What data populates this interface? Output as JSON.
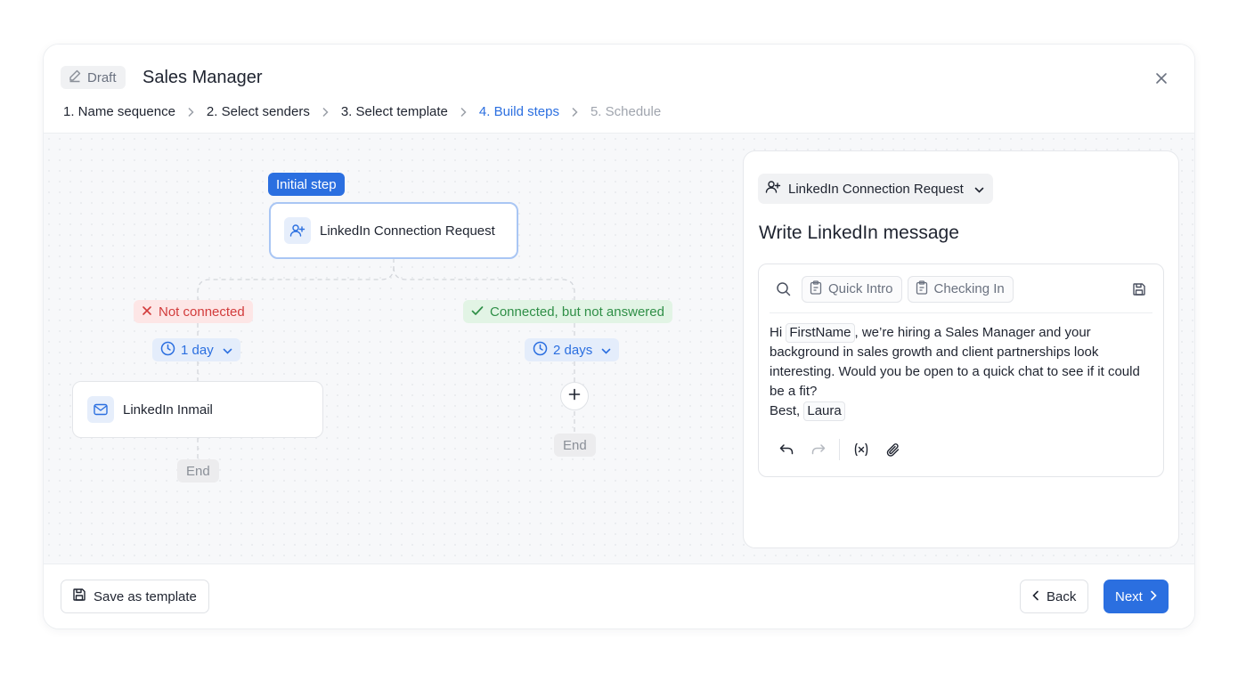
{
  "header": {
    "status_badge": "Draft",
    "title": "Sales Manager",
    "steps": [
      {
        "label": "1. Name sequence"
      },
      {
        "label": "2. Select senders"
      },
      {
        "label": "3. Select template"
      },
      {
        "label": "4. Build steps"
      },
      {
        "label": "5. Schedule"
      }
    ],
    "active_step": "4. Build steps"
  },
  "flow": {
    "initial_tag": "Initial step",
    "root_node": "LinkedIn Connection Request",
    "branches": [
      {
        "condition": "Not connected",
        "delay": "1 day",
        "node": "LinkedIn Inmail",
        "end": "End"
      },
      {
        "condition": "Connected, but not answered",
        "delay": "2 days",
        "end": "End"
      }
    ]
  },
  "panel": {
    "type_select": "LinkedIn Connection Request",
    "title": "Write LinkedIn message",
    "templates": [
      "Quick Intro",
      "Checking In"
    ],
    "message": {
      "greeting": "Hi",
      "first_name_var": "FirstName",
      "body": ", we’re hiring a Sales Manager and your background in sales growth and client partnerships look interesting. Would you be open to a quick chat to see if it could be a fit?",
      "signoff": "Best,",
      "sender_var": "Laura"
    }
  },
  "footer": {
    "save_template": "Save as template",
    "back": "Back",
    "next": "Next"
  },
  "colors": {
    "accent": "#2b6fe0",
    "danger": "#d23b3b",
    "success": "#2f8f47"
  }
}
